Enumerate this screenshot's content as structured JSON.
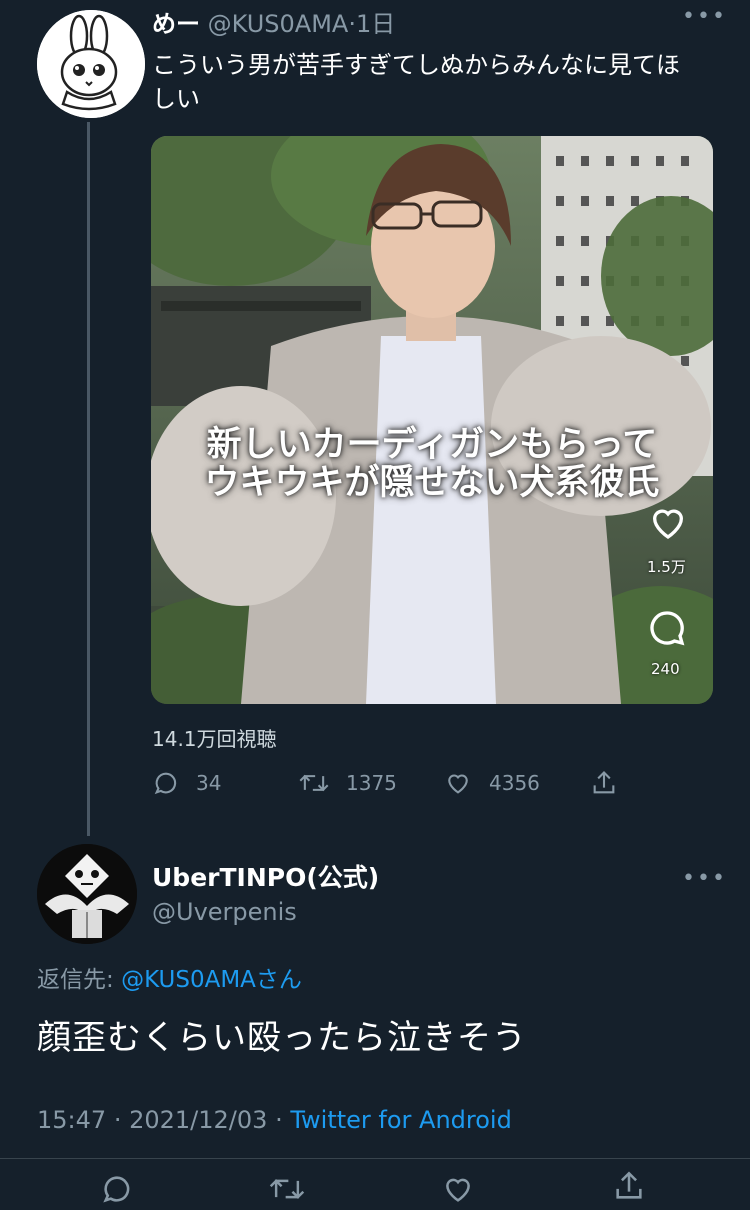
{
  "tweet1": {
    "author_name": "めー",
    "handle": "@KUS0AMA",
    "time": "1日",
    "text": "こういう男が苦手すぎてしぬからみんなに見てほしい",
    "video": {
      "caption_line1": "新しいカーディガンもらって",
      "caption_line2": "ウキウキが隠せない犬系彼氏",
      "side_like_count": "1.5万",
      "side_comment_count": "240"
    },
    "views": "14.1万回視聴",
    "reply_count": "34",
    "retweet_count": "1375",
    "like_count": "4356"
  },
  "tweet2": {
    "author_name": "UberTINPO(公式)",
    "handle": "@Uverpenis",
    "reply_label": "返信先:",
    "reply_handle": "@KUS0AMAさん",
    "text": "顔歪むくらい殴ったら泣きそう",
    "time": "15:47",
    "date": "2021/12/03",
    "client": "Twitter for Android"
  },
  "icons": [
    "more-icon",
    "reply-icon",
    "retweet-icon",
    "like-icon",
    "share-icon",
    "heart-icon",
    "comment-icon"
  ],
  "colors": {
    "background": "#15202b",
    "muted": "#8899a6",
    "link": "#1d9bf0"
  }
}
